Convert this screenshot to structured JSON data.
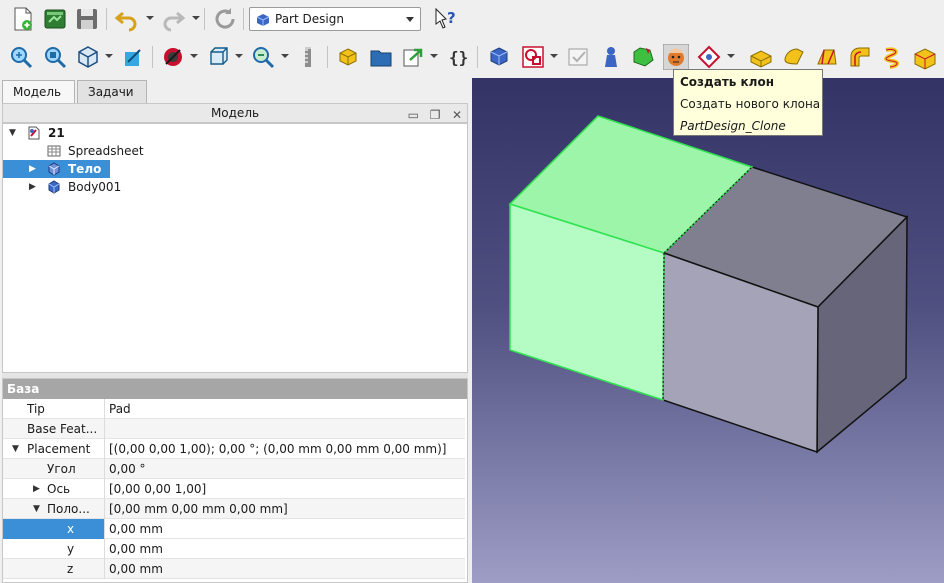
{
  "toolbar_top": {
    "icons": [
      "new-document-icon",
      "open-document-icon",
      "save-icon",
      "undo-icon",
      "redo-icon",
      "refresh-icon",
      "whats-this-icon"
    ],
    "workbench": {
      "label": "Part Design",
      "icon": "part-design-icon"
    }
  },
  "toolbar_main": {
    "icons": [
      "fit-all-icon",
      "fit-selection-icon",
      "isometric-view-icon",
      "axonometric-view-icon",
      "draw-style-icon",
      "bounding-box-icon",
      "measure-icon",
      "measure-distance-icon",
      "part-icon",
      "group-icon",
      "link-icon",
      "macro-icon",
      "create-body-icon",
      "create-sketch-icon",
      "validate-sketch-icon",
      "shape-binder-icon",
      "subshape-binder-icon",
      "clone-icon",
      "datum-plane-icon",
      "pad-icon",
      "revolution-icon",
      "additive-loft-icon",
      "additive-pipe-icon",
      "additive-helix-icon",
      "additive-primitive-icon"
    ]
  },
  "tooltip": {
    "title": "Создать клон",
    "description": "Создать нового клона",
    "command": "PartDesign_Clone"
  },
  "tabs": [
    {
      "label": "Модель",
      "active": true
    },
    {
      "label": "Задачи",
      "active": false
    }
  ],
  "model_panel": {
    "title": "Модель"
  },
  "tree": [
    {
      "label": "21",
      "icon": "document-icon",
      "bold": true
    },
    {
      "label": "Spreadsheet",
      "icon": "spreadsheet-icon"
    },
    {
      "label": "Тело",
      "icon": "body-icon",
      "selected": true
    },
    {
      "label": "Body001",
      "icon": "body-icon"
    }
  ],
  "properties": {
    "group": "База",
    "rows": [
      {
        "name": "Tip",
        "value": "Pad"
      },
      {
        "name": "Base Feat...",
        "value": ""
      },
      {
        "name": "Placement",
        "value": "[(0,00 0,00 1,00); 0,00 °; (0,00 mm  0,00 mm  0,00 mm)]"
      },
      {
        "name": "Угол",
        "value": "0,00 °"
      },
      {
        "name": "Ось",
        "value": "[0,00 0,00 1,00]"
      },
      {
        "name": "Поло...",
        "value": "[0,00 mm  0,00 mm  0,00 mm]"
      },
      {
        "name": "x",
        "value": "0,00 mm"
      },
      {
        "name": "y",
        "value": "0,00 mm"
      },
      {
        "name": "z",
        "value": "0,00 mm"
      }
    ]
  },
  "colors": {
    "selection": "#3a8fd6",
    "highlight_face": "#9cf5a9",
    "box_front": "#a4a3b8",
    "box_top": "#807f8f",
    "box_side": "#66657a"
  }
}
